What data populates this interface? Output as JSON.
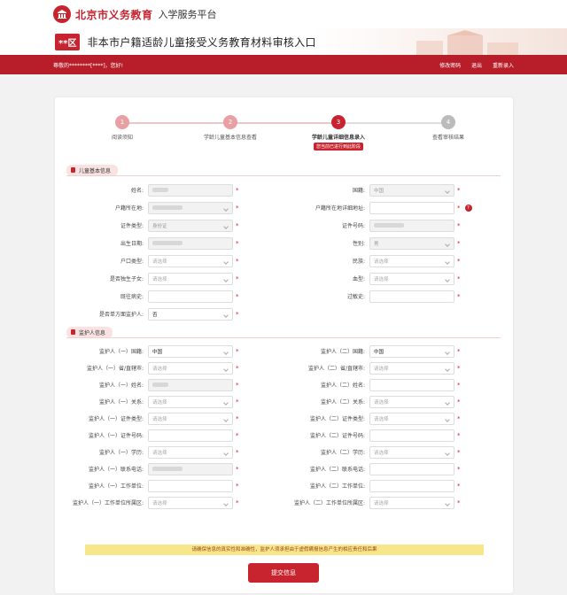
{
  "header": {
    "brand": "北京市义务教育",
    "brand_sub": "入学服务平台",
    "logo_icon": "school-logo-icon"
  },
  "banner": {
    "district": "**区",
    "title": "非本市户籍适龄儿童接受义务教育材料审核入口"
  },
  "userbar": {
    "greeting": "尊敬的********[****]，您好!",
    "change_password": "修改密码",
    "logout": "退出",
    "re_enter": "重新录入"
  },
  "steps": [
    {
      "num": "1",
      "label": "阅读须知"
    },
    {
      "num": "2",
      "label": "学龄儿童基本信息查看"
    },
    {
      "num": "3",
      "label": "学龄儿童详细信息录入",
      "tag": "您当前已进行到此阶段"
    },
    {
      "num": "4",
      "label": "查看审核结果"
    }
  ],
  "child_section": {
    "title": "儿童基本信息",
    "left": [
      {
        "label": "姓名:",
        "value": ""
      },
      {
        "label": "户籍所在地:",
        "value": ""
      },
      {
        "label": "证件类型:",
        "value": "身份证"
      },
      {
        "label": "出生日期:",
        "value": ""
      },
      {
        "label": "户口类型:",
        "value": "请选择"
      },
      {
        "label": "是否独生子女:",
        "value": "请选择"
      },
      {
        "label": "既往病史:",
        "value": ""
      },
      {
        "label": "是否单方面监护人:",
        "value": "否"
      }
    ],
    "right": [
      {
        "label": "国籍:",
        "value": "中国"
      },
      {
        "label": "户籍所在地详细地址:",
        "value": "",
        "help": "?"
      },
      {
        "label": "证件号码:",
        "value": ""
      },
      {
        "label": "性别:",
        "value": "男"
      },
      {
        "label": "民族:",
        "value": "请选择"
      },
      {
        "label": "血型:",
        "value": "请选择"
      },
      {
        "label": "过敏史:",
        "value": ""
      }
    ]
  },
  "guardian_section": {
    "title": "监护人信息",
    "left": [
      {
        "label": "监护人（一）国籍:",
        "value": "中国"
      },
      {
        "label": "监护人（一）省/直辖市:",
        "value": "请选择"
      },
      {
        "label": "监护人（一）姓名:",
        "value": ""
      },
      {
        "label": "监护人（一）关系:",
        "value": "请选择"
      },
      {
        "label": "监护人（一）证件类型:",
        "value": "请选择"
      },
      {
        "label": "监护人（一）证件号码:",
        "value": ""
      },
      {
        "label": "监护人（一）学历:",
        "value": "请选择"
      },
      {
        "label": "监护人（一）联系电话:",
        "value": ""
      },
      {
        "label": "监护人（一）工作单位:",
        "value": ""
      },
      {
        "label": "监护人（一）工作单位所属区:",
        "value": "请选择"
      }
    ],
    "right": [
      {
        "label": "监护人（二）国籍:",
        "value": "中国"
      },
      {
        "label": "监护人（二）省/直辖市:",
        "value": "请选择"
      },
      {
        "label": "监护人（二）姓名:",
        "value": ""
      },
      {
        "label": "监护人（二）关系:",
        "value": "请选择"
      },
      {
        "label": "监护人（二）证件类型:",
        "value": "请选择"
      },
      {
        "label": "监护人（二）证件号码:",
        "value": ""
      },
      {
        "label": "监护人（二）学历:",
        "value": "请选择"
      },
      {
        "label": "监护人（二）联系电话:",
        "value": ""
      },
      {
        "label": "监护人（二）工作单位:",
        "value": ""
      },
      {
        "label": "监护人（二）工作单位所属区:",
        "value": "请选择"
      }
    ]
  },
  "notice": "请确保信息的真实性和准确性，监护人须承担由于虚假瞒报信息产生的相应责任和后果",
  "submit_label": "提交信息",
  "colors": {
    "brand_red": "#c8242f",
    "userbar_red": "#b81e2a",
    "notice_yellow": "#f7e78a"
  }
}
